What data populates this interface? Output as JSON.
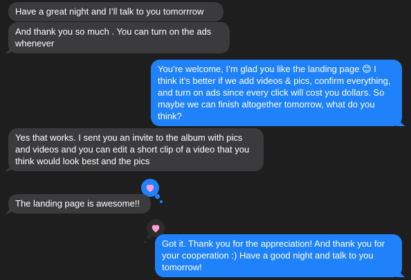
{
  "messages": [
    {
      "side": "received",
      "text": "Have a great night and I’ll talk to you tomorrrow"
    },
    {
      "side": "received",
      "text": "And thank you so much . You can turn on the ads whenever"
    },
    {
      "side": "sent",
      "text": "You’re welcome, I’m glad you like the landing page 😊 I think it’s better if we add videos & pics, confirm everything, and turn on ads since every click will cost you dollars. So maybe we can finish altogether tomorrow, what do you think?"
    },
    {
      "side": "received",
      "text": "Yes that works. I sent you an invite to the album with pics and videos and you can edit a short clip of a video that you think would look best and the pics"
    },
    {
      "side": "received",
      "text": "The landing page is awesome!!",
      "tapback": "heart-icon"
    },
    {
      "side": "sent",
      "text": "Got it. Thank you for the appreciation! And thank you for your cooperation :) Have a good night and talk to you tomorrow!",
      "tapback": "heart-icon"
    }
  ],
  "colors": {
    "background": "#1e1e1e",
    "received_bubble": "#3b3b3d",
    "sent_bubble": "#1f82fb",
    "heart": "#ff9ed2"
  }
}
